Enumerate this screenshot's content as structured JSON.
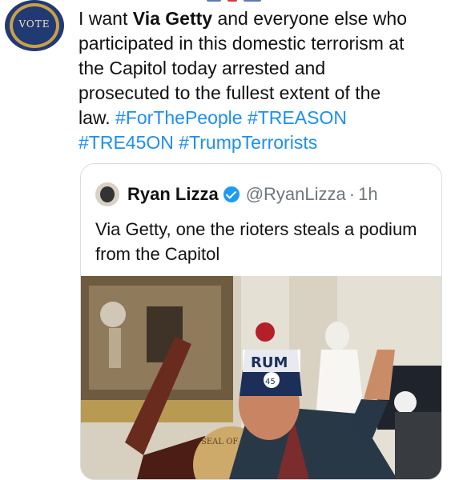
{
  "author": {
    "avatar_text": "VOTE"
  },
  "tweet": {
    "line1_prefix": "I want ",
    "line1_bold": "Via Getty",
    "line1_suffix": " and everyone else who",
    "line2": "participated in this domestic terrorism at",
    "line3": "the Capitol today arrested and",
    "line4": "prosecuted to the fullest extent of the",
    "line5_prefix": "law. ",
    "hashtags": [
      "#ForThePeople",
      "#TREASON",
      "#TRE45ON",
      "#TrumpTerrorists"
    ]
  },
  "quote": {
    "name": "Ryan Lizza",
    "handle": "@RyanLizza",
    "separator": "·",
    "time": "1h",
    "text": "Via Getty, one the rioters steals a podium from the Capitol",
    "photo": {
      "hat_text": "RUM",
      "hat_badge": "45",
      "seal_text": "SEAL OF THE SPEAKER"
    }
  }
}
